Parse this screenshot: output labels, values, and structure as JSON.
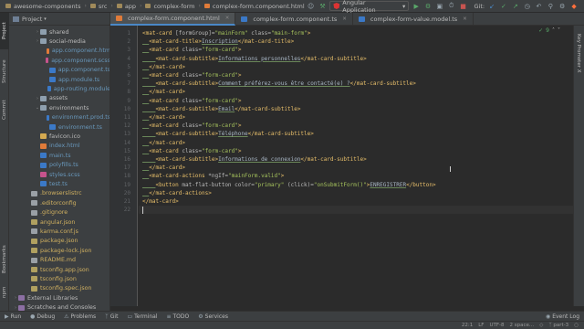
{
  "navbar": {
    "breadcrumbs": [
      "awesome-components",
      "src",
      "app",
      "complex-form",
      "complex-form.component.html"
    ],
    "run_config": "Angular Application",
    "git_label": "Git:"
  },
  "left_stripe": {
    "project": "Project",
    "structure": "Structure",
    "commit": "Commit",
    "bookmarks": "Bookmarks",
    "npm": "npm"
  },
  "right_stripe": {
    "key_promoter": "Key Promoter X"
  },
  "project_panel": {
    "title": "Project",
    "items": [
      {
        "label": "shared",
        "type": "dir"
      },
      {
        "label": "social-media",
        "type": "dir"
      },
      {
        "label": "app.component.htm",
        "type": "html"
      },
      {
        "label": "app.component.scss",
        "type": "scss"
      },
      {
        "label": "app.component.ts",
        "type": "ts"
      },
      {
        "label": "app.module.ts",
        "type": "ts"
      },
      {
        "label": "app-routing.module",
        "type": "ts"
      },
      {
        "label": "assets",
        "type": "dir"
      },
      {
        "label": "environments",
        "type": "dir"
      },
      {
        "label": "environment.prod.ts",
        "type": "ts"
      },
      {
        "label": "environment.ts",
        "type": "ts"
      },
      {
        "label": "favicon.ico",
        "type": "ico"
      },
      {
        "label": "index.html",
        "type": "html"
      },
      {
        "label": "main.ts",
        "type": "ts"
      },
      {
        "label": "polyfills.ts",
        "type": "ts"
      },
      {
        "label": "styles.scss",
        "type": "scss"
      },
      {
        "label": "test.ts",
        "type": "ts"
      },
      {
        "label": ".browserslistrc",
        "type": "file"
      },
      {
        "label": ".editorconfig",
        "type": "file"
      },
      {
        "label": ".gitignore",
        "type": "file"
      },
      {
        "label": "angular.json",
        "type": "json"
      },
      {
        "label": "karma.conf.js",
        "type": "file"
      },
      {
        "label": "package.json",
        "type": "json"
      },
      {
        "label": "package-lock.json",
        "type": "json"
      },
      {
        "label": "README.md",
        "type": "file"
      },
      {
        "label": "tsconfig.app.json",
        "type": "json"
      },
      {
        "label": "tsconfig.json",
        "type": "json"
      },
      {
        "label": "tsconfig.spec.json",
        "type": "json"
      },
      {
        "label": "External Libraries",
        "type": "lib"
      },
      {
        "label": "Scratches and Consoles",
        "type": "lib"
      }
    ]
  },
  "tabs": [
    {
      "label": "complex-form.component.html",
      "active": true
    },
    {
      "label": "complex-form.component.ts",
      "active": false
    },
    {
      "label": "complex-form-value.model.ts",
      "active": false
    }
  ],
  "editor": {
    "inspection_count": "9",
    "lines": [
      "<mat-card [formGroup]=\"mainForm\" class=\"main-form\">",
      "  <mat-card-title>Inscription</mat-card-title>",
      "  <mat-card class=\"form-card\">",
      "    <mat-card-subtitle>Informations personnelles</mat-card-subtitle>",
      "  </mat-card>",
      "  <mat-card class=\"form-card\">",
      "    <mat-card-subtitle>Comment préférez-vous être contacté(e) ?</mat-card-subtitle>",
      "  </mat-card>",
      "  <mat-card class=\"form-card\">",
      "    <mat-card-subtitle>Email</mat-card-subtitle>",
      "  </mat-card>",
      "  <mat-card class=\"form-card\">",
      "    <mat-card-subtitle>Téléphone</mat-card-subtitle>",
      "  </mat-card>",
      "  <mat-card class=\"form-card\">",
      "    <mat-card-subtitle>Informations de connexion</mat-card-subtitle>",
      "  </mat-card>",
      "  <mat-card-actions *ngIf=\"mainForm.valid\">",
      "    <button mat-flat-button color=\"primary\" (click)=\"onSubmitForm()\">ENREGISTRER</button>",
      "  </mat-card-actions>",
      "</mat-card>",
      ""
    ]
  },
  "bottom_tabs": [
    "Run",
    "Debug",
    "Problems",
    "Git",
    "Terminal",
    "TODO",
    "Services",
    "Event Log"
  ],
  "status": {
    "position": "22:1",
    "line_sep": "LF",
    "encoding": "UTF-8",
    "indent": "2 space...",
    "branch": "part-3"
  }
}
